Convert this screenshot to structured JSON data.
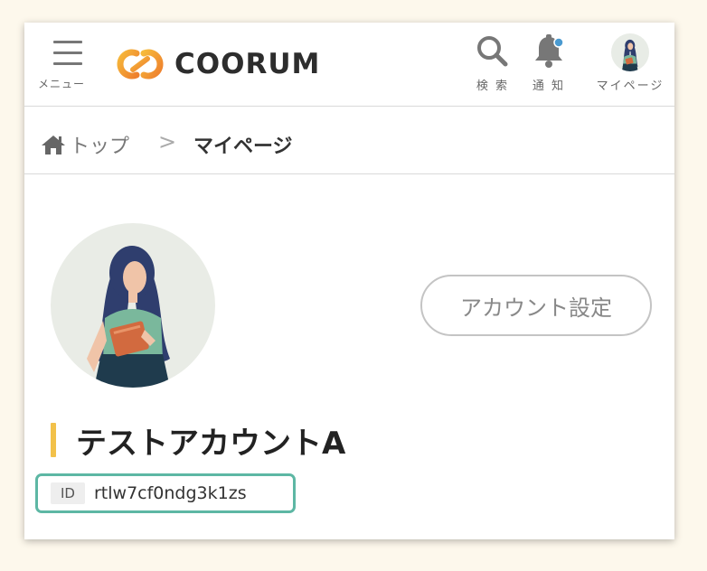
{
  "header": {
    "menu_label": "メニュー",
    "logo_text": "COORUM",
    "search_label": "検 索",
    "notification_label": "通 知",
    "mypage_label": "マイページ",
    "notification_dot_color": "#4a9ad0"
  },
  "breadcrumb": {
    "home_label": "トップ",
    "separator": ">",
    "current": "マイページ"
  },
  "profile": {
    "settings_button_label": "アカウント設定",
    "account_name": "テストアカウントA",
    "id_tag": "ID",
    "id_value": "rtlw7cf0ndg3k1zs"
  },
  "colors": {
    "accent_yellow": "#f2c14a",
    "id_border": "#5db7a4",
    "logo_orange": "#f29a2e"
  }
}
